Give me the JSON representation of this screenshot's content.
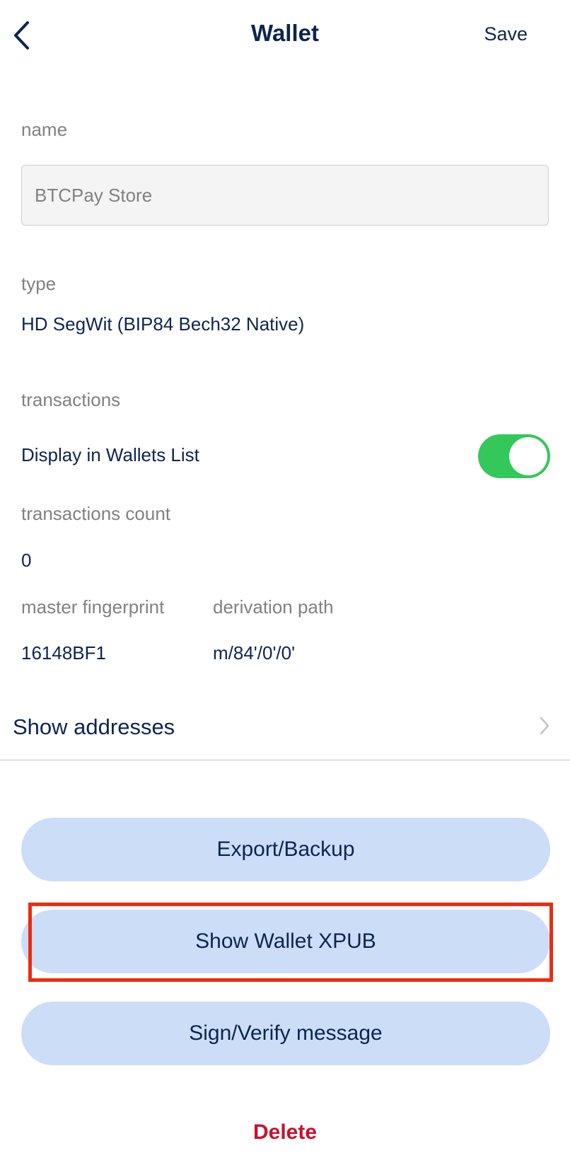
{
  "header": {
    "title": "Wallet",
    "save_label": "Save",
    "back_icon": "chevron-left-icon"
  },
  "name_section": {
    "label": "name",
    "input_value": "BTCPay Store"
  },
  "type_section": {
    "label": "type",
    "value": "HD SegWit (BIP84 Bech32 Native)"
  },
  "transactions_section": {
    "label": "transactions",
    "display_in_list_label": "Display in Wallets List",
    "display_in_list_enabled": true,
    "count_label": "transactions count",
    "count_value": "0"
  },
  "details": {
    "fingerprint_label": "master fingerprint",
    "fingerprint_value": "16148BF1",
    "derivation_label": "derivation path",
    "derivation_value": "m/84'/0'/0'"
  },
  "show_addresses": {
    "label": "Show addresses",
    "icon": "chevron-right-icon"
  },
  "actions": {
    "export_backup": "Export/Backup",
    "show_xpub": "Show Wallet XPUB",
    "sign_verify": "Sign/Verify message",
    "delete": "Delete"
  },
  "colors": {
    "text_primary": "#0c2550",
    "label_gray": "#818181",
    "toggle_on": "#34c759",
    "button_bg": "#ccddf8",
    "delete_red": "#c8102e",
    "highlight": "#ee2b0f"
  }
}
